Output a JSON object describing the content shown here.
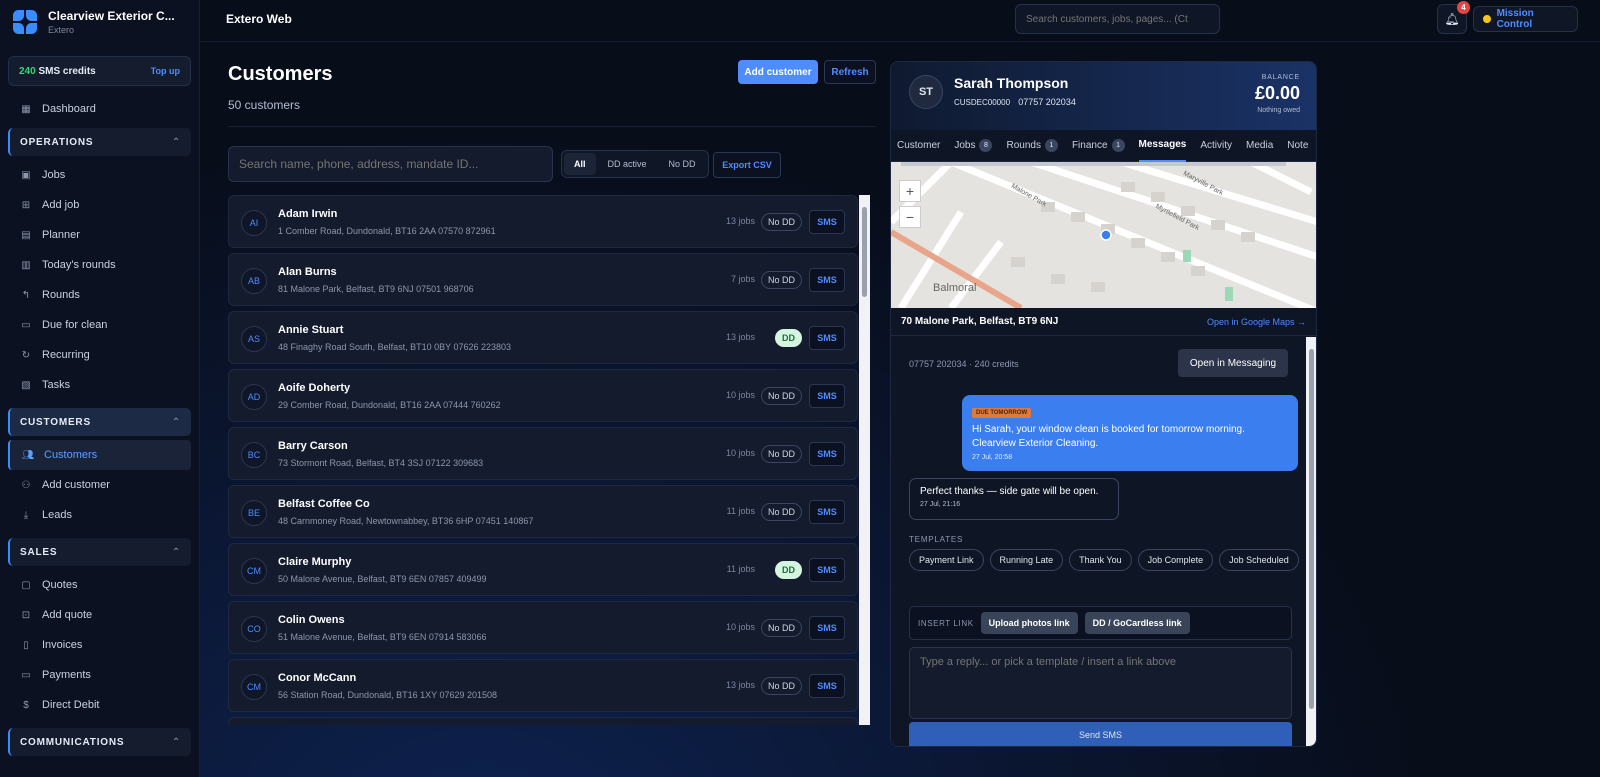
{
  "brand": {
    "name": "Clearview Exterior C...",
    "sub": "Extero"
  },
  "sms_credits": {
    "count": "240",
    "label": "SMS credits",
    "topup": "Top up"
  },
  "nav": {
    "dashboard": "Dashboard",
    "operations": {
      "title": "OPERATIONS",
      "items": [
        "Jobs",
        "Add job",
        "Planner",
        "Today's rounds",
        "Rounds",
        "Due for clean",
        "Recurring",
        "Tasks"
      ]
    },
    "customers": {
      "title": "CUSTOMERS",
      "items": [
        "Customers",
        "Add customer",
        "Leads"
      ]
    },
    "sales": {
      "title": "SALES",
      "items": [
        "Quotes",
        "Add quote",
        "Invoices",
        "Payments",
        "Direct Debit"
      ]
    },
    "communications": {
      "title": "COMMUNICATIONS"
    }
  },
  "topbar": {
    "title": "Extero Web",
    "search_placeholder": "Search customers, jobs, pages... (Ct",
    "notifications": "4",
    "mission": "Mission Control"
  },
  "customers": {
    "title": "Customers",
    "count": "50 customers",
    "add_button": "Add customer",
    "refresh_button": "Refresh",
    "search_placeholder": "Search name, phone, address, mandate ID...",
    "filters": [
      "All",
      "DD active",
      "No DD"
    ],
    "export": "Export CSV",
    "sms_label": "SMS",
    "rows": [
      {
        "initials": "AI",
        "name": "Adam Irwin",
        "address": "1 Comber Road, Dundonald, BT16 2AA   07570 872961",
        "jobs": "13 jobs",
        "dd": "No DD"
      },
      {
        "initials": "AB",
        "name": "Alan Burns",
        "address": "81 Malone Park, Belfast, BT9 6NJ   07501 968706",
        "jobs": "7 jobs",
        "dd": "No DD"
      },
      {
        "initials": "AS",
        "name": "Annie Stuart",
        "address": "48 Finaghy Road South, Belfast, BT10 0BY   07626 223803",
        "jobs": "13 jobs",
        "dd": "DD"
      },
      {
        "initials": "AD",
        "name": "Aoife Doherty",
        "address": "29 Comber Road, Dundonald, BT16 2AA   07444 760262",
        "jobs": "10 jobs",
        "dd": "No DD"
      },
      {
        "initials": "BC",
        "name": "Barry Carson",
        "address": "73 Stormont Road, Belfast, BT4 3SJ   07122 309683",
        "jobs": "10 jobs",
        "dd": "No DD"
      },
      {
        "initials": "BE",
        "name": "Belfast Coffee Co",
        "address": "48 Carnmoney Road, Newtownabbey, BT36 6HP   07451 140867",
        "jobs": "11 jobs",
        "dd": "No DD"
      },
      {
        "initials": "CM",
        "name": "Claire Murphy",
        "address": "50 Malone Avenue, Belfast, BT9 6EN   07857 409499",
        "jobs": "11 jobs",
        "dd": "DD"
      },
      {
        "initials": "CO",
        "name": "Colin Owens",
        "address": "51 Malone Avenue, Belfast, BT9 6EN   07914 583066",
        "jobs": "10 jobs",
        "dd": "No DD"
      },
      {
        "initials": "CM",
        "name": "Conor McCann",
        "address": "56 Station Road, Dundonald, BT16 1XY   07629 201508",
        "jobs": "13 jobs",
        "dd": "No DD"
      }
    ]
  },
  "detail": {
    "initials": "ST",
    "name": "Sarah Thompson",
    "id": "CUSDEC00000",
    "phone": "07757 202034",
    "balance_label": "BALANCE",
    "balance": "£0.00",
    "balance_sub": "Nothing owed",
    "tabs": [
      {
        "label": "Customer",
        "count": ""
      },
      {
        "label": "Jobs",
        "count": "8"
      },
      {
        "label": "Rounds",
        "count": "1"
      },
      {
        "label": "Finance",
        "count": "1"
      },
      {
        "label": "Messages",
        "count": ""
      },
      {
        "label": "Activity",
        "count": ""
      },
      {
        "label": "Media",
        "count": ""
      },
      {
        "label": "Note",
        "count": ""
      }
    ],
    "map": {
      "area": "Balmoral",
      "streets": [
        "Maryville Park",
        "Malone Park",
        "Myrtlefield Park"
      ],
      "zoom_in": "+",
      "zoom_out": "−"
    },
    "address": "70 Malone Park, Belfast, BT9 6NJ",
    "google_link": "Open in Google Maps →",
    "messages": {
      "credits_line": "07757 202034 · 240 credits",
      "open_button": "Open in Messaging",
      "outgoing": {
        "tag": "DUE TOMORROW",
        "text": "Hi Sarah, your window clean is booked for tomorrow morning. Clearview Exterior Cleaning.",
        "time": "27 Jul, 20:58"
      },
      "incoming": {
        "text": "Perfect thanks — side gate will be open.",
        "time": "27 Jul, 21:16"
      },
      "templates_label": "TEMPLATES",
      "templates": [
        "Payment Link",
        "Running Late",
        "Thank You",
        "Job Complete",
        "Job Scheduled"
      ],
      "insert_label": "INSERT LINK",
      "insert_buttons": [
        "Upload photos link",
        "DD / GoCardless link"
      ],
      "reply_placeholder": "Type a reply... or pick a template / insert a link above",
      "send": "Send SMS"
    }
  },
  "colors": {
    "accent": "#4f8cff",
    "dd_active_bg": "#d6f5e0",
    "badge": "#e74444"
  }
}
